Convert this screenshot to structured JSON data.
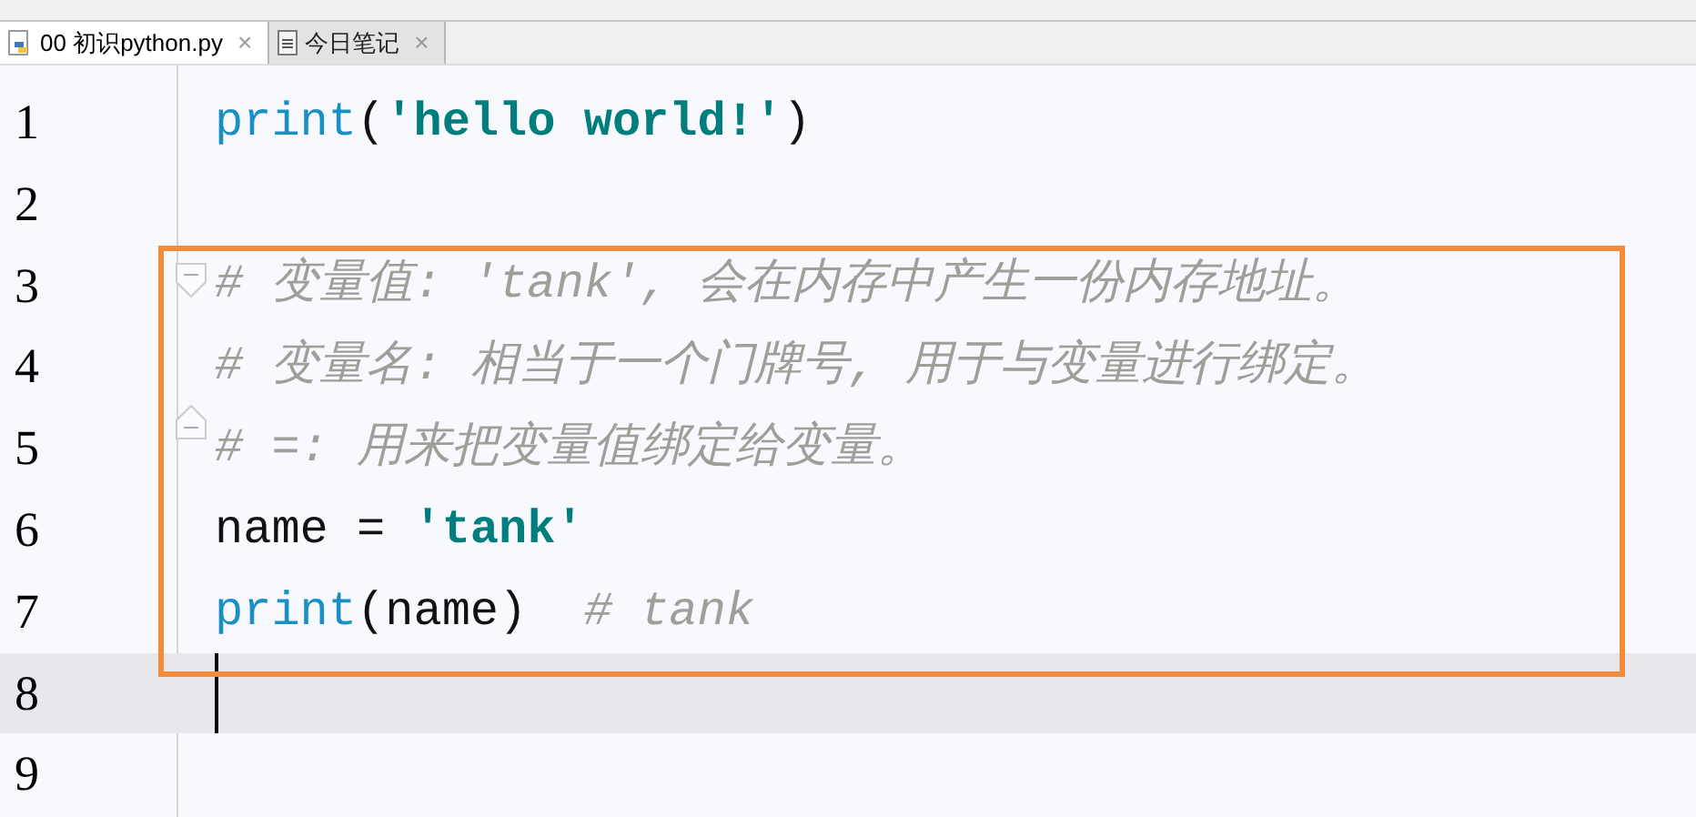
{
  "tabs": [
    {
      "label": "00 初识python.py",
      "selected": true,
      "kind": "python",
      "close": "×"
    },
    {
      "label": "今日笔记",
      "selected": false,
      "kind": "note",
      "close": "×"
    }
  ],
  "editor": {
    "lines": [
      {
        "number": "1",
        "current": false,
        "kind": "code",
        "tokens": [
          {
            "kind": "builtin",
            "text": "print"
          },
          {
            "kind": "plain",
            "text": "("
          },
          {
            "kind": "string",
            "text": "'hello world!'"
          },
          {
            "kind": "plain",
            "text": ")"
          }
        ]
      },
      {
        "number": "2",
        "current": false,
        "kind": "code"
      },
      {
        "number": "3",
        "current": false,
        "kind": "fold_start",
        "tokens": [
          {
            "kind": "comment",
            "text": "# 变量值: 'tank', 会在内存中产生一份内存地址。"
          }
        ]
      },
      {
        "number": "4",
        "current": false,
        "kind": "code",
        "tokens": [
          {
            "kind": "comment",
            "text": "# 变量名: 相当于一个门牌号, 用于与变量进行绑定。"
          }
        ]
      },
      {
        "number": "5",
        "current": false,
        "kind": "fold_end",
        "tokens": [
          {
            "kind": "comment",
            "text": "# =: 用来把变量值绑定给变量。"
          }
        ]
      },
      {
        "number": "6",
        "current": false,
        "kind": "code",
        "tokens": [
          {
            "kind": "plain",
            "text": "name = "
          },
          {
            "kind": "string",
            "text": "'tank'"
          }
        ]
      },
      {
        "number": "7",
        "current": false,
        "kind": "code",
        "tokens": [
          {
            "kind": "builtin",
            "text": "print"
          },
          {
            "kind": "plain",
            "text": "(name)  "
          },
          {
            "kind": "comment",
            "text": "# tank"
          }
        ]
      },
      {
        "number": "8",
        "current": true,
        "kind": "code"
      },
      {
        "number": "9",
        "current": false,
        "kind": "code"
      }
    ]
  }
}
